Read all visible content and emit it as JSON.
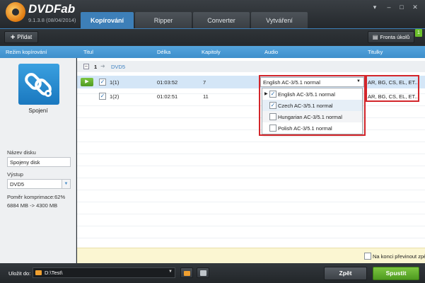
{
  "app": {
    "name": "DVDFab",
    "version": "9.1.3.8 (08/04/2014)"
  },
  "tabs": [
    {
      "label": "Kopírování",
      "active": true
    },
    {
      "label": "Ripper"
    },
    {
      "label": "Converter"
    },
    {
      "label": "Vytváření"
    }
  ],
  "toolbar": {
    "add_label": "Přidat",
    "queue_label": "Fronta úkolů",
    "queue_count": "1"
  },
  "columns": {
    "mode": "Režim kopírování",
    "title": "Titul",
    "length": "Délka",
    "chapters": "Kapitoly",
    "audio": "Audio",
    "subtitles": "Titulky"
  },
  "left_panel": {
    "mode_name": "Spojení",
    "disc_name_label": "Název disku",
    "disc_name_value": "Spojeny disk",
    "output_label": "Výstup",
    "output_value": "DVD5",
    "compression": "Poměr komprimace:62%",
    "size_info": "6884 MB -> 4300 MB"
  },
  "group": {
    "number": "1",
    "label": "DVD5"
  },
  "rows": [
    {
      "title": "1(1)",
      "length": "01:03:52",
      "chapters": "7",
      "audio": "English AC-3/5.1 normal",
      "subtitles": "AR, BG, CS, EL, ET..."
    },
    {
      "title": "1(2)",
      "length": "01:02:51",
      "chapters": "11",
      "audio": "",
      "subtitles": "AR, BG, CS, EL, ET..."
    }
  ],
  "audio_options": [
    {
      "label": "English AC-3/5.1 normal",
      "checked": true
    },
    {
      "label": "Czech AC-3/5.1 normal",
      "checked": true
    },
    {
      "label": "Hungarian AC-3/5.1 normal",
      "checked": false
    },
    {
      "label": "Polish AC-3/5.1 normal",
      "checked": false
    }
  ],
  "info_bar": {
    "text": "Na konci převinout zpět"
  },
  "bottom": {
    "save_label": "Uložit do:",
    "path": "D:\\Test\\",
    "back_label": "Zpět",
    "start_label": "Spustit"
  },
  "colors": {
    "accent": "#3d7fb8",
    "green": "#6bbf2a",
    "highlight_red": "#d3262b"
  }
}
